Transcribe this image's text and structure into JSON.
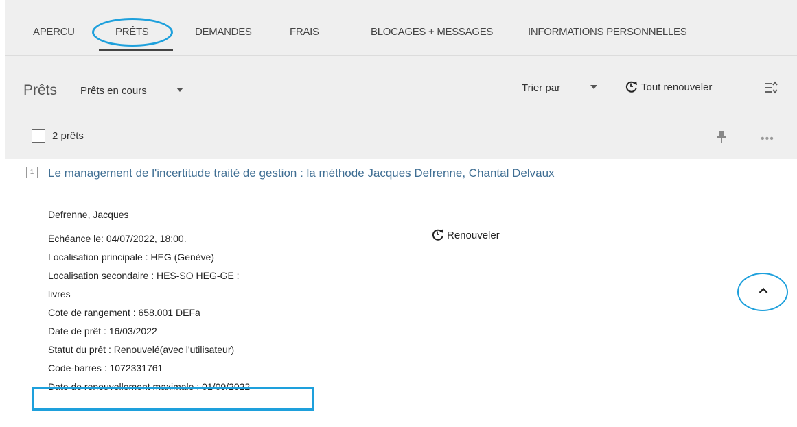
{
  "tabs": [
    {
      "label": "APERCU"
    },
    {
      "label": "PRÊTS"
    },
    {
      "label": "DEMANDES"
    },
    {
      "label": "FRAIS"
    },
    {
      "label": "BLOCAGES + MESSAGES"
    },
    {
      "label": "INFORMATIONS PERSONNELLES"
    }
  ],
  "header": {
    "title": "Prêts",
    "filter": "Prêts en cours",
    "sort_label": "Trier par",
    "renew_all_label": "Tout renouveler"
  },
  "list": {
    "count_label": "2 prêts"
  },
  "item": {
    "index": "1",
    "title": "Le management de l'incertitude traité de gestion : la méthode Jacques Defrenne, Chantal Delvaux",
    "author": "Defrenne, Jacques",
    "renew_label": "Renouveler",
    "details": [
      "Échéance le: 04/07/2022, 18:00.",
      "Localisation principale : HEG (Genève)",
      "Localisation secondaire : HES-SO HEG-GE :",
      "livres",
      "Cote de rangement : 658.001 DEFa",
      "Date de prêt : 16/03/2022",
      "Statut du prêt : Renouvelé(avec l'utilisateur)",
      "Code-barres : 1072331761",
      "Date de renouvellement maximale : 01/09/2022"
    ]
  },
  "colors": {
    "accent_highlight": "#1ea0dc",
    "link": "#3f6e93",
    "panel_bg": "#efefef"
  },
  "icons": [
    "renew-clock-icon",
    "sort-options-icon",
    "pin-icon",
    "more-icon",
    "chevron-up-icon",
    "dropdown-caret-icon"
  ]
}
